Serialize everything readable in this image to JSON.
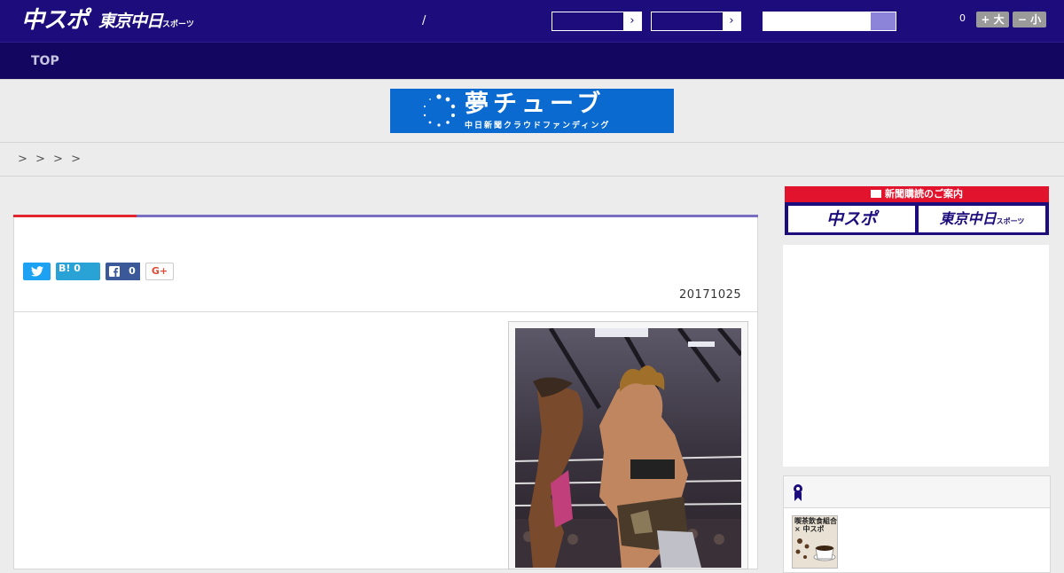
{
  "header": {
    "logo_text": "中スポ",
    "logo2_text": "東京中日",
    "logo2_sub": "スポーツ",
    "separator": "/",
    "font_count": "0",
    "font_larger": "+ 大",
    "font_smaller": "− 小"
  },
  "nav": {
    "items": [
      {
        "label": "TOP"
      }
    ]
  },
  "banner": {
    "title": "夢チューブ",
    "subtitle": "中日新聞クラウドファンディング"
  },
  "breadcrumb": {
    "text": "> > > >"
  },
  "article": {
    "share": {
      "twitter_icon": "twitter-icon",
      "hatena": "B! 0",
      "facebook_count": "0",
      "gplus": "G+"
    },
    "date": "20171025"
  },
  "sidebar": {
    "subscribe_header": "新聞購読のご案内",
    "subscribe_buttons": [
      {
        "label": "中スポ"
      },
      {
        "label": "東京中日"
      }
    ],
    "subscribe_button2_sub": "スポーツ",
    "ranking_thumb_caption": "喫茶飲食組合 × 中スポ"
  },
  "colors": {
    "header_bg": "#1c0c7c",
    "nav_bg": "#120660",
    "accent_red": "#e2262e",
    "accent_purple": "#7a6ec2"
  }
}
